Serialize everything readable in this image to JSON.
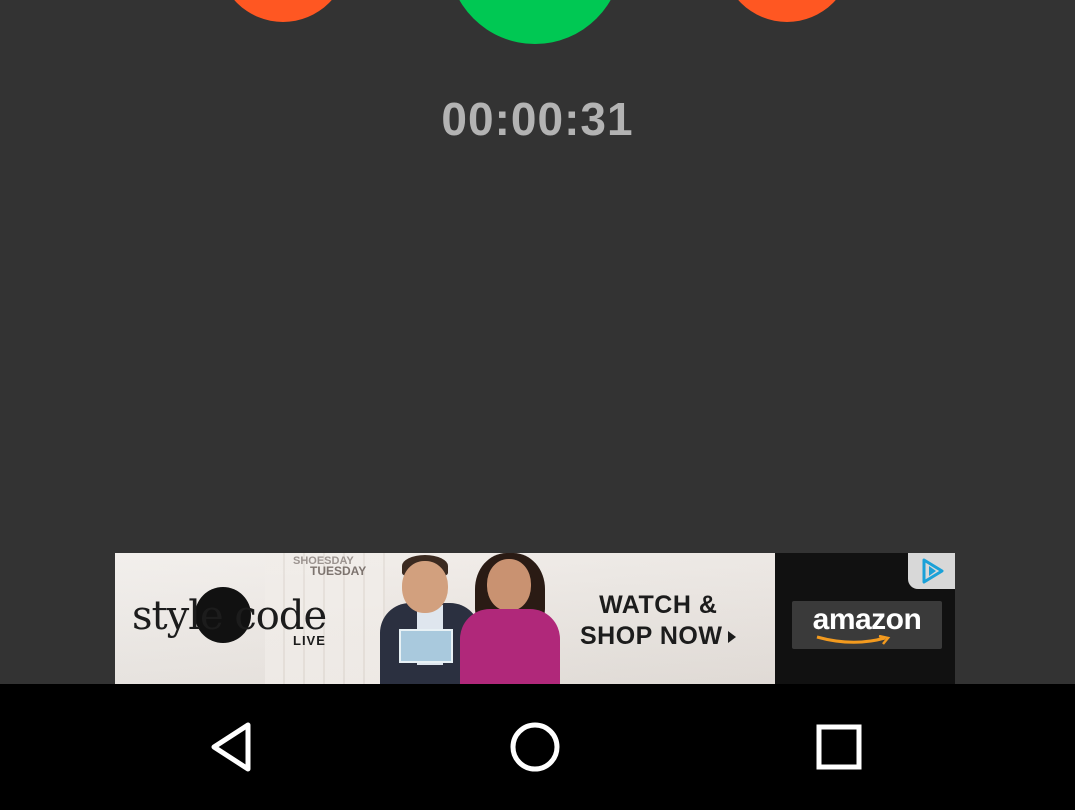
{
  "call_controls": {
    "left_button_color": "#ff5722",
    "center_button_color": "#00c853",
    "right_button_color": "#ff5722"
  },
  "timer": {
    "elapsed": "00:00:31",
    "color": "#b3b3b3"
  },
  "ad": {
    "tag_line_1": "SHOESDAY",
    "tag_line_2": "TUESDAY",
    "brand_text": "style code",
    "brand_sub": "LIVE",
    "headline_line_1": "WATCH &",
    "headline_line_2": "SHOP NOW",
    "sponsor": "amazon",
    "choices_icon": "adchoices-play-icon"
  },
  "navigation_bar": {
    "back_icon": "back-triangle-icon",
    "home_icon": "home-circle-icon",
    "recents_icon": "recents-square-icon"
  },
  "colors": {
    "background": "#333333",
    "nav_background": "#000000"
  }
}
